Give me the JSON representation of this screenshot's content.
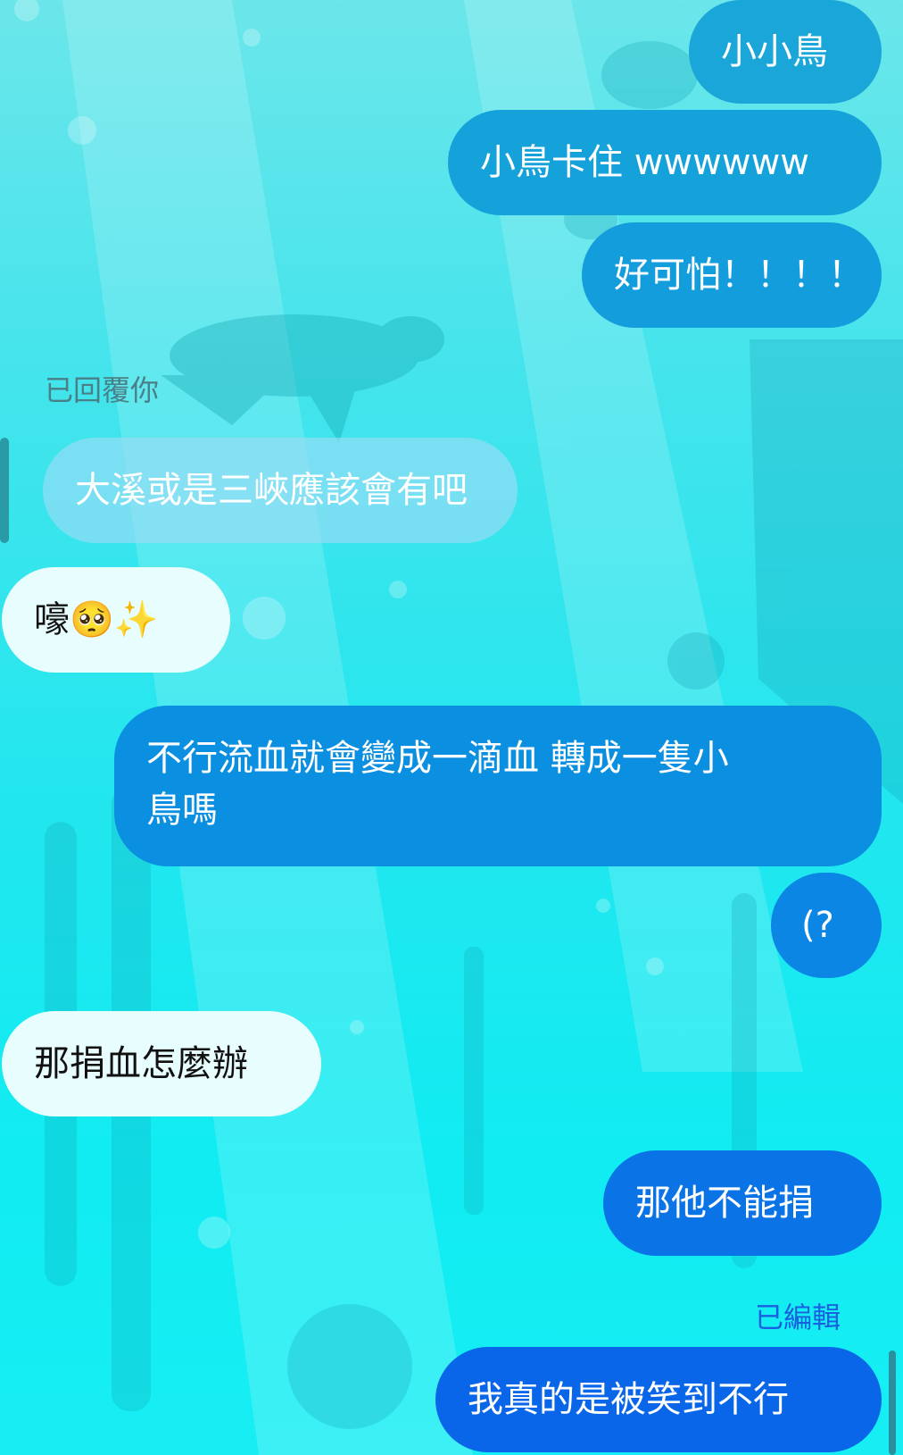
{
  "messages": [
    {
      "text": "小小鳥",
      "side": "out"
    },
    {
      "text": "小鳥卡住 wwwwww",
      "side": "out"
    },
    {
      "text": "好可怕！！！！",
      "side": "out"
    },
    {
      "text": "大溪或是三峽應該會有吧",
      "side": "in",
      "reply_quote": true
    },
    {
      "text": "嚎🥺✨",
      "side": "in"
    },
    {
      "text_line1": "不行流血就會變成一滴血  轉成一隻小",
      "text_line2": "鳥嗎",
      "side": "out"
    },
    {
      "text": "(?",
      "side": "out"
    },
    {
      "text": "那捐血怎麼辦",
      "side": "in"
    },
    {
      "text": "那他不能捐",
      "side": "out"
    },
    {
      "text": "我真的是被笑到不行",
      "side": "out",
      "edited": true
    }
  ],
  "labels": {
    "replied_to_you": "已回覆你",
    "edited": "已編輯"
  },
  "colors": {
    "outgoing_top": "#1aa6d8",
    "outgoing_bottom": "#0a66e8",
    "incoming": "#e8fdfd",
    "reply_quote": "#a0dcf5",
    "edited_label": "#1a5fe0"
  }
}
